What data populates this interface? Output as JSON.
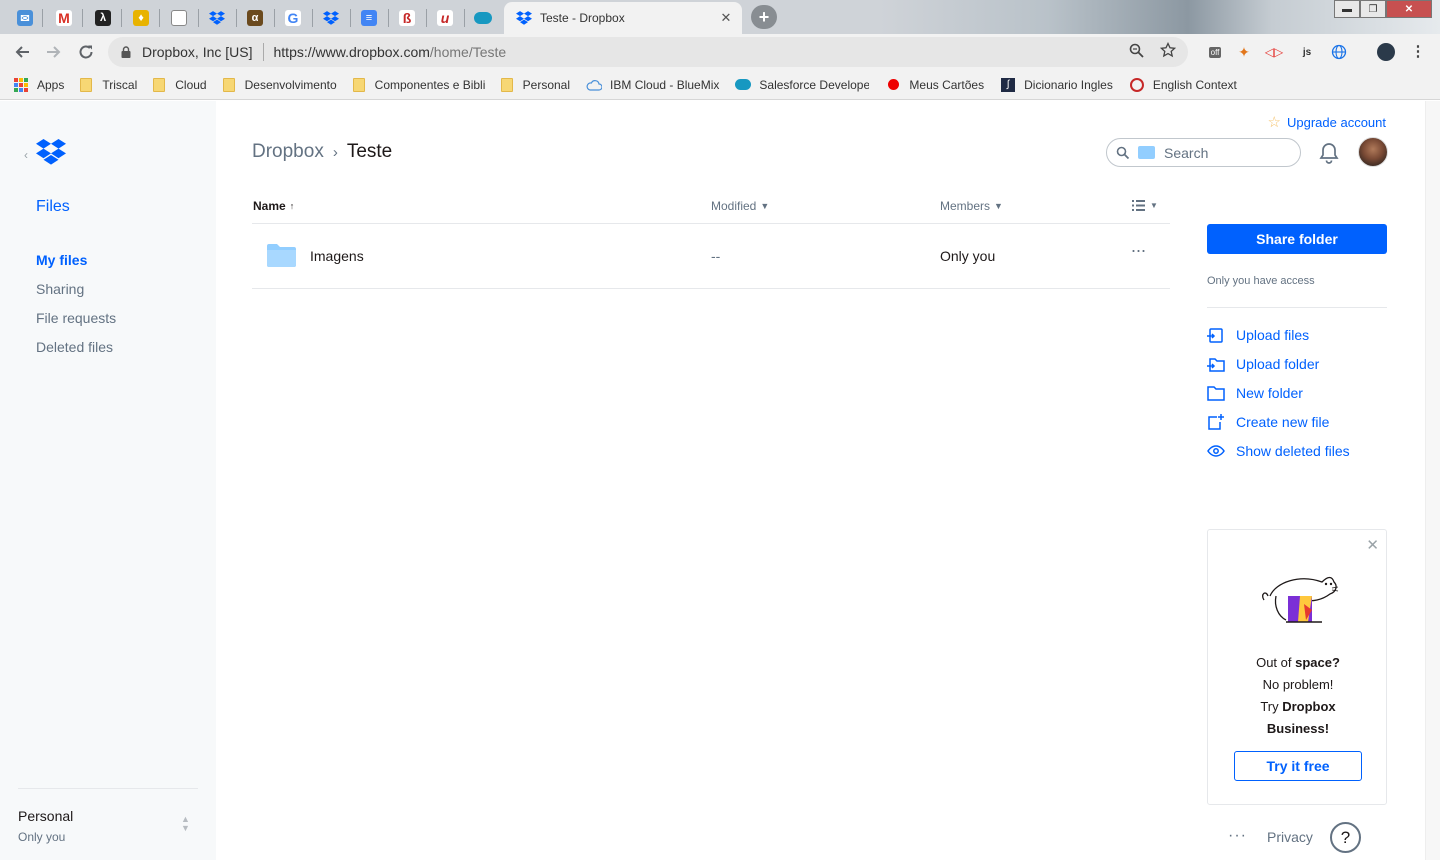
{
  "browser": {
    "tabs_pinned": [
      {
        "icon": "inbox-mail-icon",
        "color": "#4a90d9"
      },
      {
        "icon": "gmail-icon",
        "color": "#d93025"
      },
      {
        "icon": "lambda-icon",
        "color": "#222222"
      },
      {
        "icon": "keep-note-icon",
        "color": "#e8b300"
      },
      {
        "icon": "page-icon",
        "color": "#888888"
      },
      {
        "icon": "dropbox-icon",
        "color": "#0061fe"
      },
      {
        "icon": "alura-icon",
        "color": "#6b4a1e"
      },
      {
        "icon": "google-icon",
        "color": "#4285f4"
      },
      {
        "icon": "dropbox-icon",
        "color": "#0061fe"
      },
      {
        "icon": "docs-icon",
        "color": "#4285f4"
      },
      {
        "icon": "red-letter-icon",
        "color": "#c62828"
      },
      {
        "icon": "udemy-icon",
        "color": "#c62828"
      },
      {
        "icon": "salesforce-icon",
        "color": "#1798c1"
      }
    ],
    "active_tab": {
      "title": "Teste - Dropbox"
    },
    "window_controls": {
      "minimize": "▬",
      "restore": "❐",
      "close": "✕"
    },
    "omnibox": {
      "site_name": "Dropbox, Inc [US]",
      "url_host": "https://www.dropbox.com",
      "url_path": "/home/Teste"
    },
    "extensions": [
      "zoom-icon",
      "star-icon",
      "csp-off-icon",
      "metamask-icon",
      "cast-icon",
      "js-icon",
      "globe-icon",
      "profile-icon",
      "menu-icon"
    ],
    "bookmarks": [
      {
        "label": "Apps",
        "type": "apps"
      },
      {
        "label": "Triscal",
        "type": "folder"
      },
      {
        "label": "Cloud",
        "type": "folder"
      },
      {
        "label": "Desenvolvimento",
        "type": "folder"
      },
      {
        "label": "Componentes e Biblio",
        "type": "folder"
      },
      {
        "label": "Personal",
        "type": "folder"
      },
      {
        "label": "IBM Cloud - BlueMix",
        "type": "link"
      },
      {
        "label": "Salesforce Developer",
        "type": "link"
      },
      {
        "label": "Meus Cartões",
        "type": "link"
      },
      {
        "label": "Dicionario Ingles",
        "type": "link"
      },
      {
        "label": "English Context",
        "type": "link"
      }
    ]
  },
  "sidebar": {
    "section": "Files",
    "items": [
      {
        "label": "My files",
        "active": true
      },
      {
        "label": "Sharing",
        "active": false
      },
      {
        "label": "File requests",
        "active": false
      },
      {
        "label": "Deleted files",
        "active": false
      }
    ],
    "account": {
      "name": "Personal",
      "sub": "Only you"
    }
  },
  "header": {
    "upgrade": "Upgrade account",
    "breadcrumb": {
      "root": "Dropbox",
      "separator": "›",
      "current": "Teste"
    },
    "search": {
      "placeholder": "Search"
    }
  },
  "table": {
    "columns": {
      "name": "Name",
      "modified": "Modified",
      "members": "Members"
    },
    "sort_arrow": "↑",
    "rows": [
      {
        "name": "Imagens",
        "modified": "--",
        "members": "Only you",
        "more": "···"
      }
    ]
  },
  "right_panel": {
    "share_button": "Share folder",
    "access": "Only you have access",
    "actions": [
      {
        "label": "Upload files",
        "icon": "upload-files-icon"
      },
      {
        "label": "Upload folder",
        "icon": "upload-folder-icon"
      },
      {
        "label": "New folder",
        "icon": "new-folder-icon"
      },
      {
        "label": "Create new file",
        "icon": "create-file-icon"
      },
      {
        "label": "Show deleted files",
        "icon": "eye-icon"
      }
    ]
  },
  "promo": {
    "line1_a": "Out of ",
    "line1_b": "space?",
    "line2": "No problem!",
    "line3_a": "Try ",
    "line3_b": "Dropbox",
    "line4": "Business!",
    "button": "Try it free"
  },
  "footer": {
    "more": "···",
    "privacy": "Privacy",
    "help": "?"
  },
  "colors": {
    "accent": "#0061fe",
    "folder": "#92ceff",
    "muted": "#637282"
  }
}
